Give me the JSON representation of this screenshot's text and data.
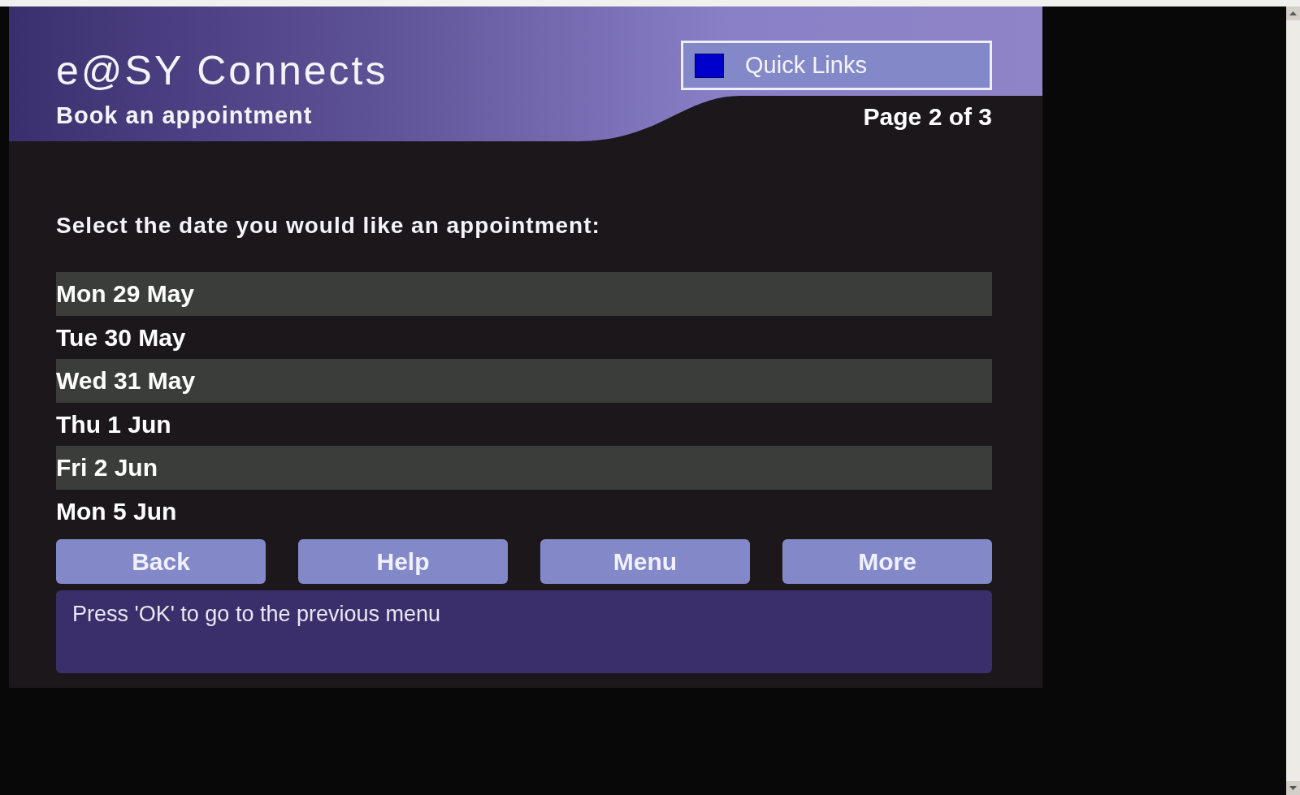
{
  "header": {
    "title": "e@SY Connects",
    "subtitle": "Book an appointment",
    "quick_links": "Quick Links",
    "page_indicator": "Page 2 of 3"
  },
  "prompt": "Select the date you would like an appointment:",
  "dates": [
    {
      "label": "Mon 29 May"
    },
    {
      "label": "Tue 30 May"
    },
    {
      "label": "Wed 31 May"
    },
    {
      "label": "Thu 1 Jun"
    },
    {
      "label": "Fri 2 Jun"
    },
    {
      "label": "Mon 5 Jun"
    }
  ],
  "buttons": [
    "Back",
    "Help",
    "Menu",
    "More"
  ],
  "message": "Press 'OK' to go to the previous menu"
}
